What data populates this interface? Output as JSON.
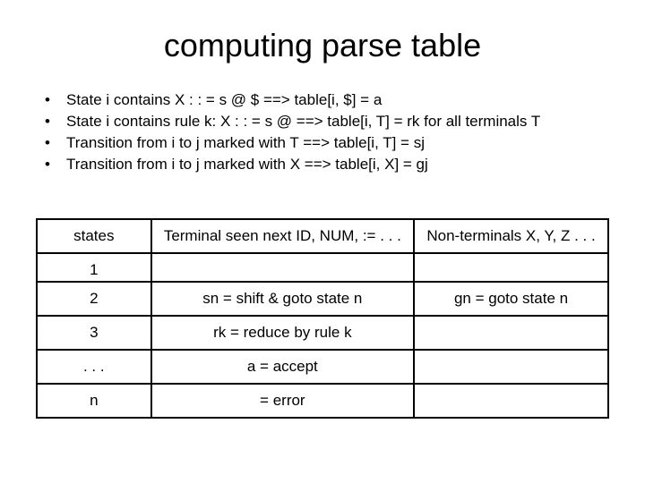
{
  "title": "computing parse table",
  "bullets": [
    "State i contains X : : = s @ $ ==> table[i, $] = a",
    "State i contains rule k: X : : = s @ ==> table[i, T] = rk for all terminals T",
    "Transition from i to j marked with T ==> table[i, T] = sj",
    "Transition from i to j marked with X ==> table[i, X] = gj"
  ],
  "table": {
    "headers": {
      "states": "states",
      "terminal": "Terminal seen next ID, NUM, := . . .",
      "nonterminals": "Non-terminals X, Y, Z . . ."
    },
    "rows": [
      {
        "state": "1",
        "terminal": "",
        "nonterm": ""
      },
      {
        "state": "2",
        "terminal": "sn = shift & goto state n",
        "nonterm": "gn = goto state n"
      },
      {
        "state": "3",
        "terminal": "rk = reduce by rule k",
        "nonterm": ""
      },
      {
        "state": ". . .",
        "terminal": "a = accept",
        "nonterm": ""
      },
      {
        "state": "n",
        "terminal": "= error",
        "nonterm": ""
      }
    ]
  }
}
